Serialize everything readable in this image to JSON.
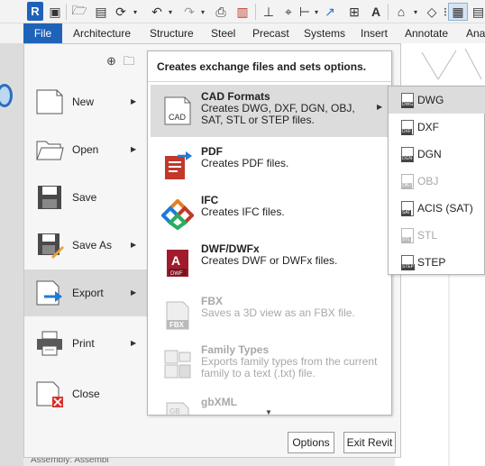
{
  "ribbon": {
    "file_tab": "File",
    "tabs": [
      "Architecture",
      "Structure",
      "Steel",
      "Precast",
      "Systems",
      "Insert",
      "Annotate",
      "Ana"
    ]
  },
  "app_menu": {
    "items": [
      {
        "label": "New",
        "has_submenu": true
      },
      {
        "label": "Open",
        "has_submenu": true
      },
      {
        "label": "Save",
        "has_submenu": false
      },
      {
        "label": "Save As",
        "has_submenu": true
      },
      {
        "label": "Export",
        "has_submenu": true,
        "active": true
      },
      {
        "label": "Print",
        "has_submenu": true
      },
      {
        "label": "Close",
        "has_submenu": false
      }
    ],
    "options_button": "Options",
    "exit_button": "Exit Revit"
  },
  "export_submenu": {
    "header": "Creates exchange files and sets options.",
    "items": [
      {
        "title": "CAD Formats",
        "desc": "Creates DWG, DXF, DGN, OBJ, SAT, STL or STEP files.",
        "icon": "cad-icon",
        "icon_text": "CAD",
        "active": true,
        "has_submenu": true
      },
      {
        "title": "PDF",
        "desc": "Creates PDF files.",
        "icon": "pdf-icon"
      },
      {
        "title": "IFC",
        "desc": "Creates IFC files.",
        "icon": "ifc-icon"
      },
      {
        "title": "DWF/DWFx",
        "desc": "Creates DWF or DWFx files.",
        "icon": "dwf-icon",
        "icon_text": "DWF"
      },
      {
        "title": "FBX",
        "desc": "Saves a 3D view as an FBX file.",
        "icon": "fbx-icon",
        "icon_text": "FBX",
        "disabled": true
      },
      {
        "title": "Family Types",
        "desc": "Exports family types from the current family to a text (.txt) file.",
        "icon": "family-types-icon",
        "disabled": true
      },
      {
        "title": "gbXML",
        "desc": "",
        "icon": "gbxml-icon",
        "icon_text": "GB",
        "disabled": true
      }
    ]
  },
  "cad_flyout": {
    "items": [
      {
        "label": "DWG",
        "tag": "DWG",
        "active": true
      },
      {
        "label": "DXF",
        "tag": "DXF"
      },
      {
        "label": "DGN",
        "tag": "DGN"
      },
      {
        "label": "OBJ",
        "tag": "OBJ",
        "disabled": true
      },
      {
        "label": "ACIS (SAT)",
        "tag": "SAT"
      },
      {
        "label": "STL",
        "tag": "STL",
        "disabled": true
      },
      {
        "label": "STEP",
        "tag": "STEP"
      }
    ]
  },
  "status": {
    "bottom_text": "Assembly: Assembl"
  },
  "colors": {
    "file_tab": "#1f63b8",
    "active_row": "#dcdcdc",
    "pdf_red": "#c0392b",
    "dwf_red": "#a01c2c",
    "accent_blue": "#1f7ad8"
  }
}
